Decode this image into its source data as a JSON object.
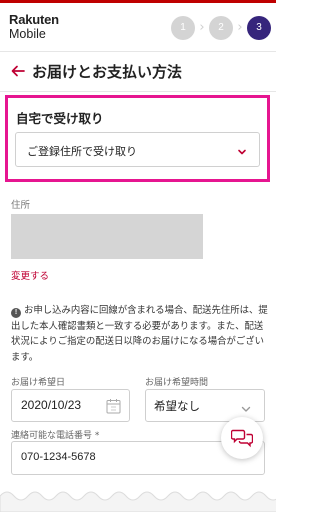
{
  "brand": {
    "line1": "Rakuten",
    "line2": "Mobile"
  },
  "steps": [
    {
      "label": "1"
    },
    {
      "label": "2"
    },
    {
      "label": "3"
    }
  ],
  "header": {
    "title": "お届けとお支払い方法"
  },
  "receive": {
    "label": "自宅で受け取り",
    "select_value": "ご登録住所で受け取り"
  },
  "address": {
    "label": "住所",
    "change_link": "変更する"
  },
  "note": {
    "icon": "!",
    "text": "お申し込み内容に回線が含まれる場合、配送先住所は、提出した本人確認書類と一致する必要があります。また、配送状況によりご指定の配送日以降のお届けになる場合がございます。"
  },
  "delivery": {
    "date_label": "お届け希望日",
    "date_value": "2020/10/23",
    "time_label": "お届け希望時間",
    "time_value": "希望なし"
  },
  "phone": {
    "label": "連絡可能な電話番号 *",
    "value": "070-1234-5678"
  },
  "colors": {
    "accent": "#bf0033",
    "highlight": "#e61590",
    "step_active": "#36257c",
    "step_inactive": "#d4d4d4"
  }
}
